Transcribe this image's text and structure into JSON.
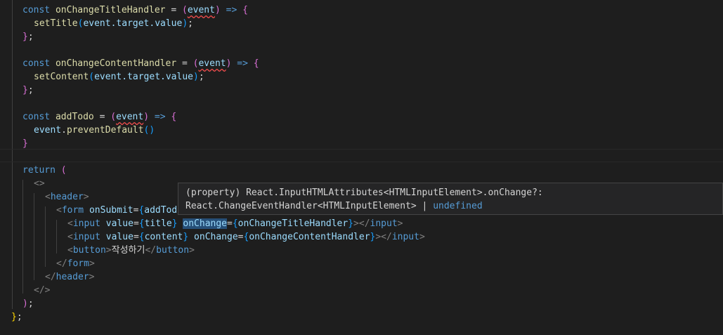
{
  "code": {
    "l1": {
      "kw": "const",
      "name": "onChangeTitleHandler",
      "eq": " = ",
      "p1": "(",
      "param": "event",
      "p1c": ")",
      "arrow": " => ",
      "brace": "{"
    },
    "l2": {
      "call": "setTitle",
      "p1": "(",
      "arg": "event.target.value",
      "p1c": ")",
      "semi": ";"
    },
    "l3": {
      "brace": "}",
      "semi": ";"
    },
    "l5": {
      "kw": "const",
      "name": "onChangeContentHandler",
      "eq": " = ",
      "p1": "(",
      "param": "event",
      "p1c": ")",
      "arrow": " => ",
      "brace": "{"
    },
    "l6": {
      "call": "setContent",
      "p1": "(",
      "arg": "event.target.value",
      "p1c": ")",
      "semi": ";"
    },
    "l7": {
      "brace": "}",
      "semi": ";"
    },
    "l9": {
      "kw": "const",
      "name": "addTodo",
      "eq": " = ",
      "p1": "(",
      "param": "event",
      "p1c": ")",
      "arrow": " => ",
      "brace": "{"
    },
    "l10": {
      "obj": "event",
      "dot": ".",
      "call": "preventDefault",
      "parens": "()"
    },
    "l11": {
      "brace": "}"
    },
    "l13": {
      "kw": "return",
      "sp": " ",
      "paren": "("
    },
    "l14": {
      "frag": "<>"
    },
    "l15": {
      "open": "<",
      "tag": "header",
      "close": ">"
    },
    "l16": {
      "open": "<",
      "tag": "form",
      "sp": " ",
      "attr": "onSubmit",
      "eq": "=",
      "lb": "{",
      "val": "addTodo"
    },
    "l17": {
      "open": "<",
      "tag": "input",
      "sp": " ",
      "attr1": "value",
      "eq1": "=",
      "lb1": "{",
      "val1": "title",
      "rb1": "}",
      "sp2": " ",
      "attr2": "onChange",
      "eq2": "=",
      "lb2": "{",
      "val2": "onChangeTitleHandler",
      "rb2": "}",
      "end": "></",
      "endtag": "input",
      "endc": ">"
    },
    "l18": {
      "open": "<",
      "tag": "input",
      "sp": " ",
      "attr1": "value",
      "eq1": "=",
      "lb1": "{",
      "val1": "content",
      "rb1": "}",
      "sp2": " ",
      "attr2": "onChange",
      "eq2": "=",
      "lb2": "{",
      "val2": "onChangeContentHandler",
      "rb2": "}",
      "end": "></",
      "endtag": "input",
      "endc": ">"
    },
    "l19": {
      "open": "<",
      "tag": "button",
      "close": ">",
      "text": "작성하기",
      "end": "</",
      "endtag": "button",
      "endc": ">"
    },
    "l20": {
      "open": "</",
      "tag": "form",
      "close": ">"
    },
    "l21": {
      "open": "</",
      "tag": "header",
      "close": ">"
    },
    "l22": {
      "frag": "</>"
    },
    "l23": {
      "paren": ")",
      "semi": ";"
    },
    "l24": {
      "brace": "}",
      "semi": ";"
    }
  },
  "hover": {
    "line1": "(property) React.InputHTMLAttributes<HTMLInputElement>.onChange?:",
    "line2a": "React.ChangeEventHandler<HTMLInputElement> | ",
    "line2b": "undefined"
  }
}
